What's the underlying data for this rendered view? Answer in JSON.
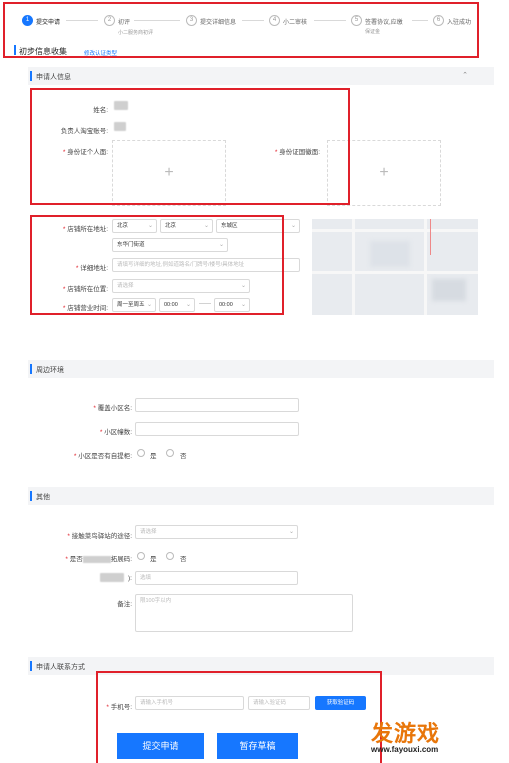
{
  "steps": [
    {
      "num": "1",
      "label": "提交申请"
    },
    {
      "num": "2",
      "label": "初评",
      "sub": "小二服务商初评"
    },
    {
      "num": "3",
      "label": "提交详细信息"
    },
    {
      "num": "4",
      "label": "小二审核"
    },
    {
      "num": "5",
      "label": "签署协议,应缴",
      "sub": "保证金"
    },
    {
      "num": "6",
      "label": "入驻成功"
    }
  ],
  "page": {
    "title": "初步信息收集",
    "title_link": "修改认证类型"
  },
  "sections": {
    "applicant": "申请人信息",
    "surroundings": "周边环境",
    "other": "其他",
    "contact": "申请人联系方式"
  },
  "applicant": {
    "name_label": "姓名:",
    "taobao_label": "负责人淘宝账号:",
    "id_front_label": "身份证个人面:",
    "id_back_label": "身份证国徽面:"
  },
  "address": {
    "region_label": "店铺所在地址:",
    "province": "北京",
    "city": "北京",
    "district": "东城区",
    "street": "东华门街道",
    "detail_label": "详细地址:",
    "detail_placeholder": "请填写详细的地址,例如道路名/门牌号/楼号/具体地址",
    "location_label": "店铺所在位置:",
    "location_placeholder": "请选择",
    "hours_label": "店铺营业时间:",
    "days": "周一至周五",
    "start": "00:00",
    "dash": "——",
    "end": "00:00"
  },
  "surroundings": {
    "community_label": "覆盖小区名:",
    "building_label": "小区幢数:",
    "locker_label": "小区是否有自提柜:",
    "yes": "是",
    "no": "否"
  },
  "other": {
    "channel_label": "接触菜鸟驿站的途径:",
    "channel_placeholder": "请选择",
    "code_label_prefix": "是否",
    "code_label_suffix": "拓展码:",
    "yes": "是",
    "no": "否",
    "blurred_suffix": "):",
    "blurred_placeholder": "选填",
    "remark_label": "备注:",
    "remark_placeholder": "限100字以内"
  },
  "contact": {
    "phone_label": "手机号:",
    "phone_placeholder": "请输入手机号",
    "code_placeholder": "请输入验证码",
    "send_code": "获取验证码"
  },
  "actions": {
    "submit": "提交申请",
    "draft": "暂存草稿"
  },
  "watermark": {
    "brand": "发游戏",
    "url": "www.fayouxi.com"
  },
  "colors": {
    "accent": "#1677ff",
    "highlight": "#e0202a",
    "required": "#e0202a"
  }
}
